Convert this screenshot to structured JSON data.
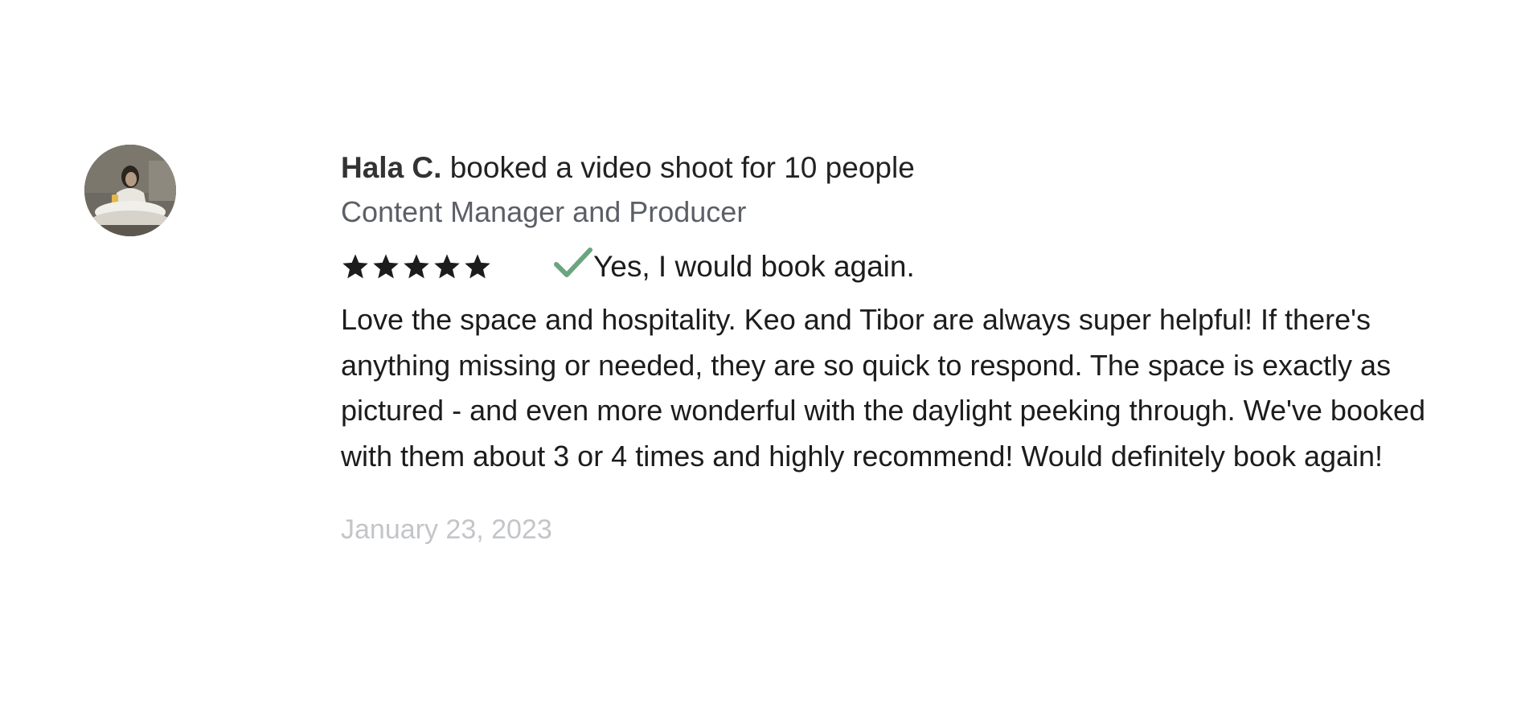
{
  "review": {
    "reviewer_name": "Hala C.",
    "booking_text": "booked a video shoot for 10 people",
    "reviewer_title": "Content Manager and Producer",
    "rating": 5,
    "rating_max": 5,
    "book_again_text": "Yes, I would book again.",
    "body": "Love the space and hospitality. Keo and Tibor are always super helpful! If there's anything missing or needed, they are so quick to respond. The space is exactly as pictured - and even more wonderful with the daylight peeking through. We've booked with them about 3 or 4 times and highly recommend! Would definitely book again!",
    "date": "January 23, 2023"
  },
  "colors": {
    "star": "#1c1c1c",
    "check": "#6aa580",
    "date": "#c3c5c8",
    "title": "#5b5f66"
  },
  "icons": {
    "star": "star-icon",
    "check": "check-icon",
    "avatar": "avatar-photo"
  }
}
